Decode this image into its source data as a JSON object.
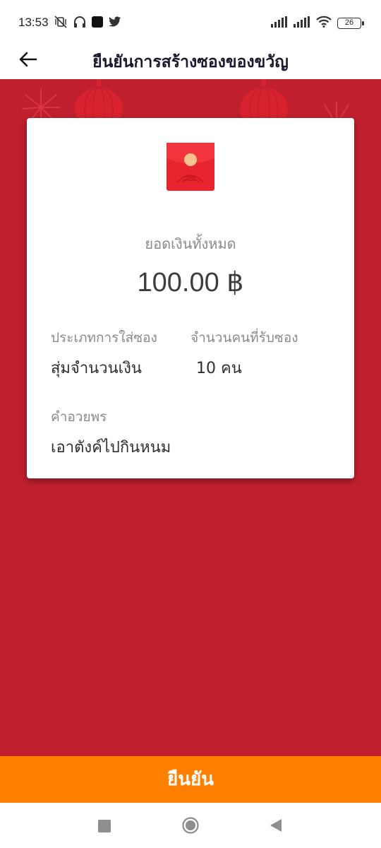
{
  "status_bar": {
    "time": "13:53",
    "battery": "26",
    "left_icons": [
      "mute-vibrate-icon",
      "headphones-icon",
      "app-square-icon",
      "twitter-icon"
    ],
    "right_icons": [
      "signal-icon",
      "signal-icon",
      "wifi-icon",
      "battery-icon"
    ]
  },
  "header": {
    "title": "ยืนยันการสร้างซองของขวัญ",
    "back_icon": "arrow-left-icon"
  },
  "card": {
    "icon": "red-envelope-icon",
    "total_label": "ยอดเงินทั้งหมด",
    "total_amount": "100.00 ฿",
    "type_label": "ประเภทการใส่ซอง",
    "type_value": "สุ่มจำนวนเงิน",
    "recipients_label": "จำนวนคนที่รับซอง",
    "recipients_value": "10 คน",
    "greeting_label": "คำอวยพร",
    "greeting_value": "เอาตังค์ไปกินหนม"
  },
  "confirm_button": {
    "label": "ยืนยัน"
  },
  "colors": {
    "background_red": "#c0202e",
    "confirm_orange": "#ff7f00",
    "decor_red": "#d8222f"
  },
  "nav_bar": {
    "icons": [
      "recent-apps-icon",
      "home-icon",
      "back-triangle-icon"
    ]
  }
}
